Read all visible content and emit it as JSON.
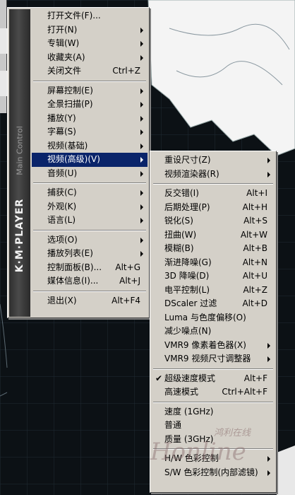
{
  "main_menu": {
    "brand": "K·M·PLAYER",
    "subtitle": "Main Control",
    "groups": [
      [
        {
          "label": "打开文件(F)...",
          "shortcut": "",
          "submenu": false
        },
        {
          "label": "打开(N)",
          "shortcut": "",
          "submenu": true
        },
        {
          "label": "专辑(W)",
          "shortcut": "",
          "submenu": true
        },
        {
          "label": "收藏夹(A)",
          "shortcut": "",
          "submenu": true
        },
        {
          "label": "关闭文件",
          "shortcut": "Ctrl+Z",
          "submenu": false
        }
      ],
      [
        {
          "label": "屏幕控制(E)",
          "shortcut": "",
          "submenu": true
        },
        {
          "label": "全景扫描(P)",
          "shortcut": "",
          "submenu": true
        },
        {
          "label": "播放(Y)",
          "shortcut": "",
          "submenu": true
        },
        {
          "label": "字幕(S)",
          "shortcut": "",
          "submenu": true
        },
        {
          "label": "视频(基础)",
          "shortcut": "",
          "submenu": true
        },
        {
          "label": "视频(高级)(V)",
          "shortcut": "",
          "submenu": true,
          "selected": true
        },
        {
          "label": "音频(U)",
          "shortcut": "",
          "submenu": true
        }
      ],
      [
        {
          "label": "捕获(C)",
          "shortcut": "",
          "submenu": true
        },
        {
          "label": "外观(K)",
          "shortcut": "",
          "submenu": true
        },
        {
          "label": "语言(L)",
          "shortcut": "",
          "submenu": true
        }
      ],
      [
        {
          "label": "选项(O)",
          "shortcut": "",
          "submenu": true
        },
        {
          "label": "播放列表(E)",
          "shortcut": "",
          "submenu": true
        },
        {
          "label": "控制面板(B)...",
          "shortcut": "Alt+G",
          "submenu": false
        },
        {
          "label": "媒体信息(I)...",
          "shortcut": "Alt+J",
          "submenu": false
        }
      ],
      [
        {
          "label": "退出(X)",
          "shortcut": "Alt+F4",
          "submenu": false
        }
      ]
    ]
  },
  "submenu": {
    "groups": [
      [
        {
          "label": "重设尺寸(Z)",
          "shortcut": "",
          "submenu": true
        },
        {
          "label": "视频渲染器(R)",
          "shortcut": "",
          "submenu": true
        }
      ],
      [
        {
          "label": "反交错(I)",
          "shortcut": "Alt+I"
        },
        {
          "label": "后期处理(P)",
          "shortcut": "Alt+H"
        },
        {
          "label": "锐化(S)",
          "shortcut": "Alt+S"
        },
        {
          "label": "扭曲(W)",
          "shortcut": "Alt+W"
        },
        {
          "label": "模糊(B)",
          "shortcut": "Alt+B"
        },
        {
          "label": "渐进降噪(G)",
          "shortcut": "Alt+N"
        },
        {
          "label": "3D 降噪(D)",
          "shortcut": "Alt+U"
        },
        {
          "label": "电平控制(L)",
          "shortcut": "Alt+Z"
        },
        {
          "label": "DScaler 过滤",
          "shortcut": "Alt+D"
        },
        {
          "label": "Luma 与色度偏移(O)",
          "shortcut": ""
        },
        {
          "label": "减少噪点(N)",
          "shortcut": ""
        },
        {
          "label": "VMR9 像素着色器(X)",
          "shortcut": "",
          "submenu": true
        },
        {
          "label": "VMR9 视频尺寸调整器",
          "shortcut": "",
          "submenu": true
        }
      ],
      [
        {
          "label": "超级速度模式",
          "shortcut": "Alt+F",
          "checked": true
        },
        {
          "label": "高速模式",
          "shortcut": "Ctrl+Alt+F"
        }
      ],
      [
        {
          "label": "速度 (1GHz)",
          "shortcut": ""
        },
        {
          "label": "普通",
          "shortcut": ""
        },
        {
          "label": "质量 (3GHz)",
          "shortcut": ""
        }
      ],
      [
        {
          "label": "H/W 色彩控制",
          "shortcut": "",
          "submenu": true
        },
        {
          "label": "S/W 色彩控制(内部滤镜)",
          "shortcut": "",
          "submenu": true
        }
      ]
    ]
  },
  "watermark": {
    "cn": "鸿利在线",
    "en": "Honline"
  },
  "colors": {
    "menu_bg": "#d4d0c8",
    "highlight": "#0a246a",
    "background": "#0d1216"
  }
}
